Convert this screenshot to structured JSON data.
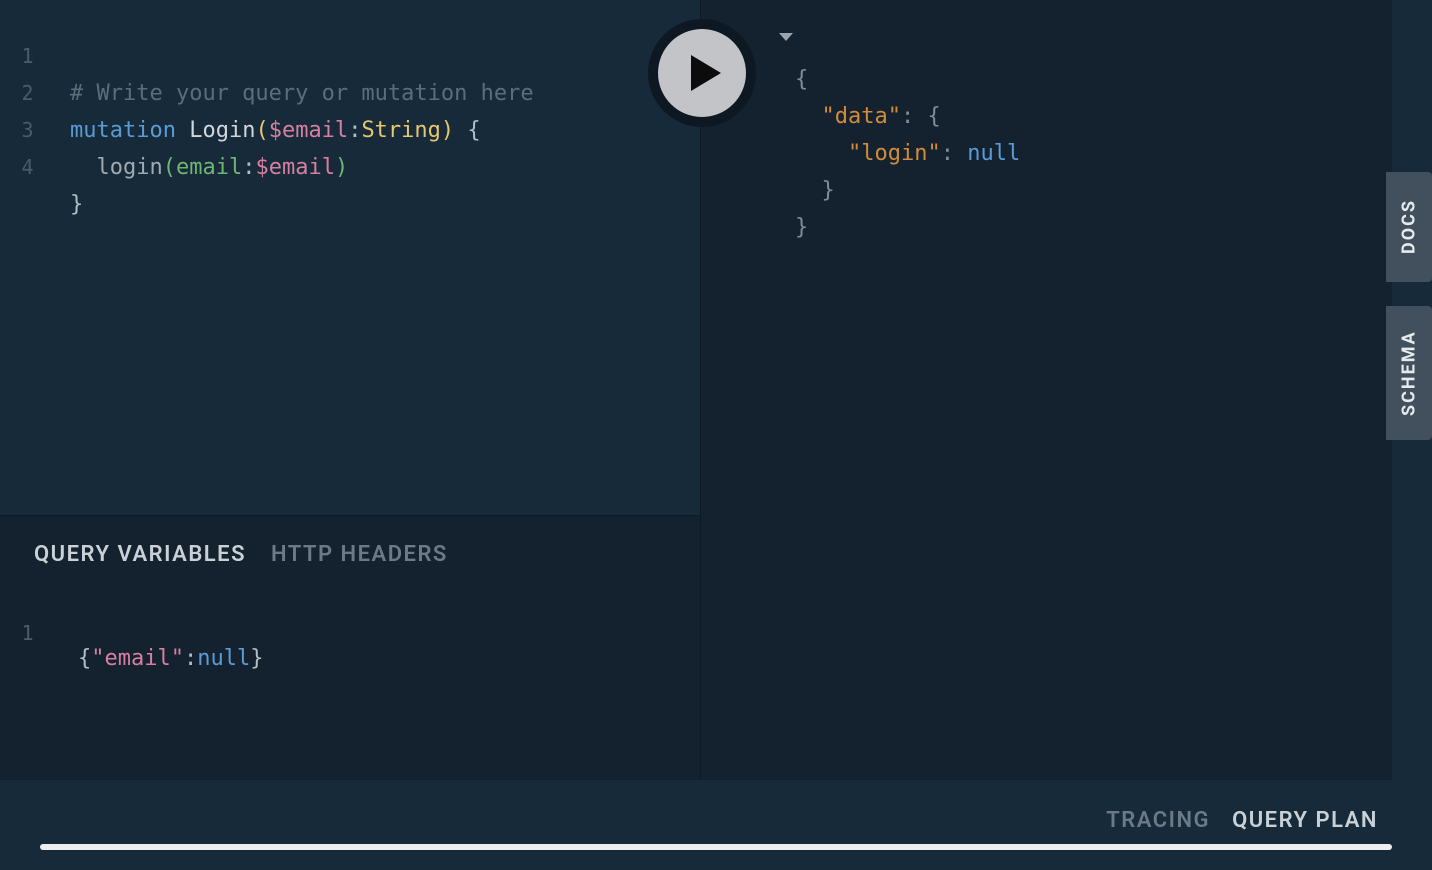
{
  "editor": {
    "line_numbers": [
      "1",
      "2",
      "3",
      "4"
    ],
    "l1_comment": "# Write your query or mutation here",
    "l2": {
      "kw": "mutation",
      "name": "Login",
      "lparen": "(",
      "var": "$email",
      "colon": ":",
      "type": "String",
      "rparen": ")",
      "brace": " {"
    },
    "l3": {
      "indent": "  ",
      "field": "login",
      "lparen": "(",
      "arg": "email",
      "colon": ":",
      "var": "$email",
      "rparen": ")"
    },
    "l4_brace": "}"
  },
  "vars": {
    "tab_query_variables": "QUERY VARIABLES",
    "tab_http_headers": "HTTP HEADERS",
    "line_number": "1",
    "code": {
      "lbrace": "{",
      "key": "\"email\"",
      "colon": ":",
      "value": "null",
      "rbrace": "}"
    }
  },
  "result": {
    "l1": "{",
    "l2_key": "\"data\"",
    "l2_colon": ": ",
    "l2_brace": "{",
    "l3_key": "\"login\"",
    "l3_colon": ": ",
    "l3_val": "null",
    "l4": "}",
    "l5": "}"
  },
  "sidetabs": {
    "docs": "DOCS",
    "schema": "SCHEMA"
  },
  "footer": {
    "tracing": "TRACING",
    "query_plan": "QUERY PLAN"
  }
}
